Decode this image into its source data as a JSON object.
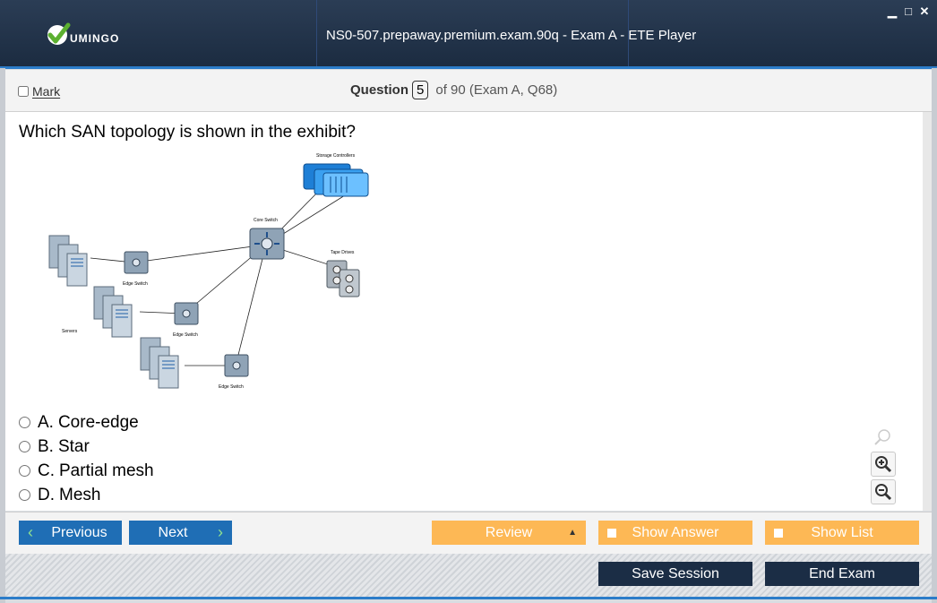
{
  "window": {
    "title": "NS0-507.prepaway.premium.exam.90q - Exam A - ETE Player",
    "logo_text": "UMINGO"
  },
  "question_bar": {
    "mark_label": "Mark",
    "question_label": "Question",
    "question_number": "5",
    "question_suffix": "of 90 (Exam A, Q68)"
  },
  "question": {
    "text": "Which SAN topology is shown in the exhibit?",
    "exhibit_labels": {
      "storage_controllers": "Storage Controllers",
      "core_switch": "Core Switch",
      "tape_drives": "Tape Drives",
      "servers": "Servers",
      "edge_switch_1": "Edge Switch",
      "edge_switch_2": "Edge Switch",
      "edge_switch_3": "Edge Switch"
    },
    "answers": [
      {
        "letter": "A.",
        "text": "Core-edge"
      },
      {
        "letter": "B.",
        "text": "Star"
      },
      {
        "letter": "C.",
        "text": "Partial mesh"
      },
      {
        "letter": "D.",
        "text": "Mesh"
      }
    ]
  },
  "nav": {
    "previous": "Previous",
    "next": "Next",
    "review": "Review",
    "show_answer": "Show Answer",
    "show_list": "Show List",
    "save_session": "Save Session",
    "end_exam": "End Exam"
  },
  "colors": {
    "titlebar": "#1b2b40",
    "accent_blue": "#1f6eb5",
    "accent_orange": "#fdb855",
    "dark_button": "#1b2d45"
  },
  "icons": [
    "logo-check-icon",
    "minimize-icon",
    "maximize-icon",
    "close-icon",
    "chevron-left-icon",
    "chevron-right-icon",
    "triangle-up-icon",
    "search-icon",
    "zoom-in-icon",
    "zoom-out-icon"
  ]
}
